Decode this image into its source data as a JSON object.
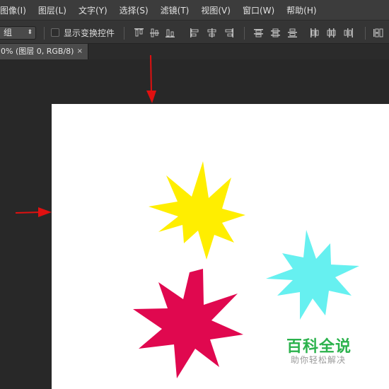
{
  "menu": [
    {
      "label": "图像(I)"
    },
    {
      "label": "图层(L)"
    },
    {
      "label": "文字(Y)"
    },
    {
      "label": "选择(S)"
    },
    {
      "label": "滤镜(T)"
    },
    {
      "label": "视图(V)"
    },
    {
      "label": "窗口(W)"
    },
    {
      "label": "帮助(H)"
    }
  ],
  "options": {
    "auto_select_value": "组",
    "show_transform_label": "显示变换控件",
    "show_transform_checked": false
  },
  "document_tab": {
    "title": "0% (图层 0, RGB/8)",
    "close_glyph": "×"
  },
  "canvas": {
    "background": "#ffffff",
    "shapes": [
      {
        "name": "yellow-star",
        "color": "#ffee00"
      },
      {
        "name": "cyan-star",
        "color": "#66f0f0"
      },
      {
        "name": "crimson-star",
        "color": "#e0084f"
      }
    ]
  },
  "watermark": {
    "title": "百科全说",
    "subtitle": "助你轻松解决"
  },
  "colors": {
    "annotation_arrow": "#e01010",
    "watermark_green": "#2bb24c"
  }
}
